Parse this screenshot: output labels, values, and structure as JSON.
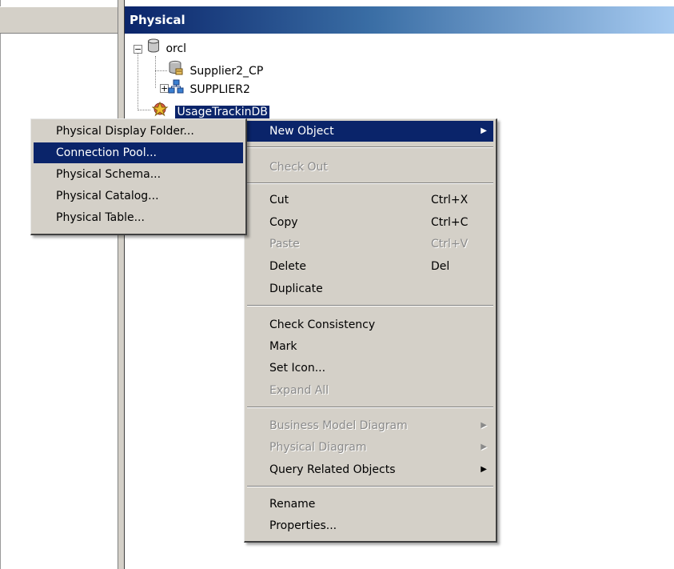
{
  "panes": {
    "physical_title": "Physical"
  },
  "tree": {
    "db_label": "orcl",
    "pool_label": "Supplier2_CP",
    "schema_label": "SUPPLIER2",
    "selected_label": "UsageTrackinDB"
  },
  "context_menu": {
    "items": [
      {
        "label": "New Object",
        "shortcut": "",
        "state": "highlighted",
        "submenu": true
      },
      {
        "label": "Check Out",
        "shortcut": "",
        "state": "disabled"
      },
      {
        "label": "Cut",
        "shortcut": "Ctrl+X",
        "state": "enabled"
      },
      {
        "label": "Copy",
        "shortcut": "Ctrl+C",
        "state": "enabled"
      },
      {
        "label": "Paste",
        "shortcut": "Ctrl+V",
        "state": "disabled"
      },
      {
        "label": "Delete",
        "shortcut": "Del",
        "state": "enabled"
      },
      {
        "label": "Duplicate",
        "shortcut": "",
        "state": "enabled"
      },
      {
        "label": "Check Consistency",
        "shortcut": "",
        "state": "enabled"
      },
      {
        "label": "Mark",
        "shortcut": "",
        "state": "enabled"
      },
      {
        "label": "Set Icon...",
        "shortcut": "",
        "state": "enabled"
      },
      {
        "label": "Expand All",
        "shortcut": "",
        "state": "disabled"
      },
      {
        "label": "Business Model Diagram",
        "shortcut": "",
        "state": "disabled",
        "submenu": true
      },
      {
        "label": "Physical Diagram",
        "shortcut": "",
        "state": "disabled",
        "submenu": true
      },
      {
        "label": "Query Related Objects",
        "shortcut": "",
        "state": "enabled",
        "submenu": true
      },
      {
        "label": "Rename",
        "shortcut": "",
        "state": "enabled"
      },
      {
        "label": "Properties...",
        "shortcut": "",
        "state": "enabled"
      }
    ]
  },
  "new_object_submenu": {
    "items": [
      {
        "label": "Physical Display Folder...",
        "state": "enabled"
      },
      {
        "label": "Connection Pool...",
        "state": "highlighted"
      },
      {
        "label": "Physical Schema...",
        "state": "enabled"
      },
      {
        "label": "Physical Catalog...",
        "state": "enabled"
      },
      {
        "label": "Physical Table...",
        "state": "enabled"
      }
    ]
  },
  "colors": {
    "menu_bg": "#d4d0c8",
    "highlight": "#0a246a",
    "disabled_text": "#8a8a8a",
    "header_gradient_start": "#0a246a",
    "header_gradient_end": "#a6caf0"
  },
  "icons": [
    "database-icon",
    "connection-pool-icon",
    "schema-icon",
    "usage-db-icon",
    "submenu-arrow-icon"
  ]
}
